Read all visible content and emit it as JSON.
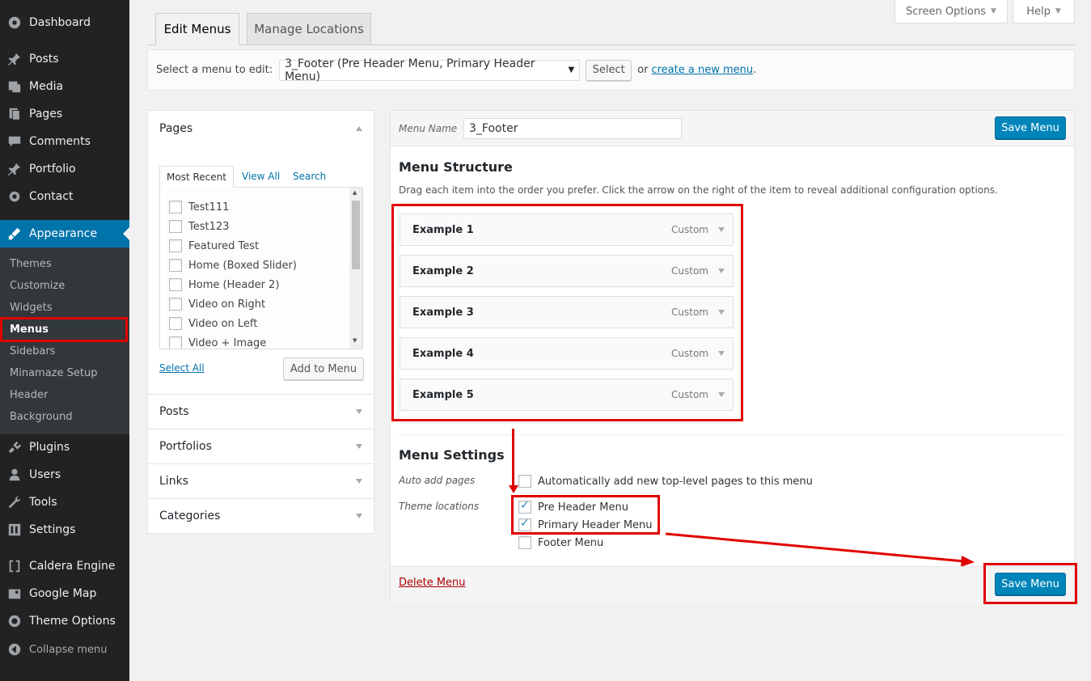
{
  "sidebar": {
    "items": [
      {
        "label": "Dashboard",
        "icon": "dashboard-icon"
      },
      {
        "label": "Posts",
        "icon": "pin-icon"
      },
      {
        "label": "Media",
        "icon": "media-icon"
      },
      {
        "label": "Pages",
        "icon": "pages-icon"
      },
      {
        "label": "Comments",
        "icon": "comment-icon"
      },
      {
        "label": "Portfolio",
        "icon": "pin-icon"
      },
      {
        "label": "Contact",
        "icon": "gear-icon"
      },
      {
        "label": "Appearance",
        "icon": "brush-icon"
      },
      {
        "label": "Plugins",
        "icon": "plug-icon"
      },
      {
        "label": "Users",
        "icon": "user-icon"
      },
      {
        "label": "Tools",
        "icon": "wrench-icon"
      },
      {
        "label": "Settings",
        "icon": "settings-icon"
      },
      {
        "label": "Caldera Engine",
        "icon": "bracket-icon"
      },
      {
        "label": "Google Map",
        "icon": "map-icon"
      },
      {
        "label": "Theme Options",
        "icon": "circle-icon"
      }
    ],
    "submenu": [
      "Themes",
      "Customize",
      "Widgets",
      "Menus",
      "Sidebars",
      "Minamaze Setup",
      "Header",
      "Background"
    ],
    "collapse_label": "Collapse menu"
  },
  "top": {
    "screen_options": "Screen Options",
    "help": "Help"
  },
  "tabs": {
    "edit_menus": "Edit Menus",
    "manage_locations": "Manage Locations"
  },
  "manage": {
    "label": "Select a menu to edit:",
    "selected": "3_Footer (Pre Header Menu, Primary Header Menu)",
    "select_button": "Select",
    "or_text": "or",
    "create_link": "create a new menu",
    "period": "."
  },
  "pages_box": {
    "title": "Pages",
    "tabs": [
      "Most Recent",
      "View All",
      "Search"
    ],
    "items": [
      "Test111",
      "Test123",
      "Featured Test",
      "Home (Boxed Slider)",
      "Home (Header 2)",
      "Video on Right",
      "Video on Left",
      "Video + Image"
    ],
    "select_all": "Select All",
    "add_button": "Add to Menu"
  },
  "accordions": [
    "Posts",
    "Portfolios",
    "Links",
    "Categories"
  ],
  "menu_editor": {
    "name_label": "Menu Name",
    "name_value": "3_Footer",
    "save_label": "Save Menu",
    "structure_title": "Menu Structure",
    "structure_desc": "Drag each item into the order you prefer. Click the arrow on the right of the item to reveal additional configuration options.",
    "items": [
      {
        "title": "Example 1",
        "type": "Custom"
      },
      {
        "title": "Example 2",
        "type": "Custom"
      },
      {
        "title": "Example 3",
        "type": "Custom"
      },
      {
        "title": "Example 4",
        "type": "Custom"
      },
      {
        "title": "Example 5",
        "type": "Custom"
      }
    ],
    "settings_title": "Menu Settings",
    "auto_add_label": "Auto add pages",
    "auto_add_text": "Automatically add new top-level pages to this menu",
    "locations_label": "Theme locations",
    "locations": [
      {
        "label": "Pre Header Menu",
        "checked": true
      },
      {
        "label": "Primary Header Menu",
        "checked": true
      },
      {
        "label": "Footer Menu",
        "checked": false
      }
    ],
    "delete_label": "Delete Menu"
  },
  "colors": {
    "accent": "#0073aa",
    "primary_button": "#0085ba",
    "highlight": "#e00000",
    "sidebar": "#222222"
  }
}
